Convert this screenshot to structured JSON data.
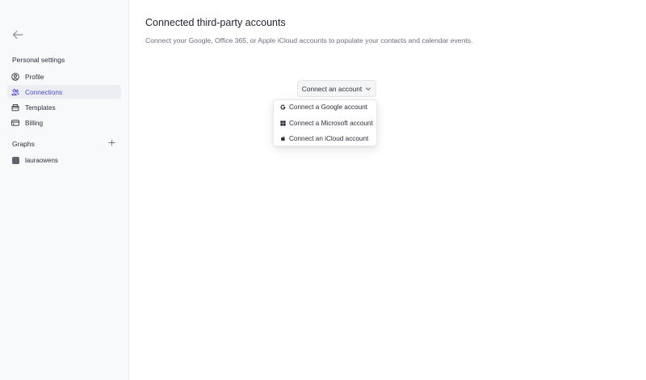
{
  "sidebar": {
    "section_title": "Personal settings",
    "items": [
      {
        "label": "Profile",
        "icon": "user-circle-icon",
        "active": false
      },
      {
        "label": "Connections",
        "icon": "users-icon",
        "active": true
      },
      {
        "label": "Templates",
        "icon": "archive-icon",
        "active": false
      },
      {
        "label": "Billing",
        "icon": "credit-card-icon",
        "active": false
      }
    ],
    "graphs_title": "Graphs",
    "graphs": [
      {
        "label": "lauraowens"
      }
    ]
  },
  "main": {
    "title": "Connected third-party accounts",
    "description": "Connect your Google, Office 365, or Apple iCloud accounts to populate your contacts and calendar events.",
    "connect_button_label": "Connect an account",
    "dropdown_items": [
      {
        "label": "Connect a Google account",
        "icon": "google-icon"
      },
      {
        "label": "Connect a Microsoft account",
        "icon": "microsoft-icon"
      },
      {
        "label": "Connect an iCloud account",
        "icon": "apple-icon"
      }
    ]
  },
  "colors": {
    "accent": "#4a4ad0",
    "sidebar_bg": "#f8f9fb",
    "active_bg": "#eceef3"
  }
}
